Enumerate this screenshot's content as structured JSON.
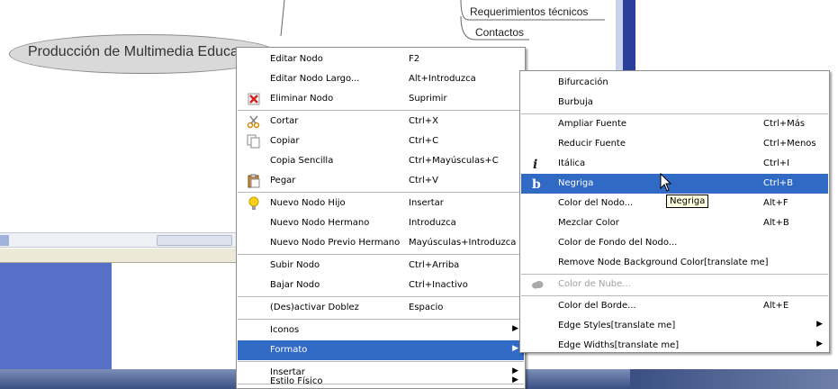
{
  "mindmap": {
    "root_label": "Producción de Multimedia Educa",
    "children": [
      "Requerimientos técnicos",
      "Contactos"
    ]
  },
  "context_menu": {
    "items": [
      {
        "label": "Editar Nodo",
        "shortcut": "F2",
        "icon": null
      },
      {
        "label": "Editar Nodo Largo...",
        "shortcut": "Alt+Introduzca",
        "icon": null
      },
      {
        "label": "Eliminar Nodo",
        "shortcut": "Suprimir",
        "icon": "red-x-delete-icon"
      },
      {
        "label": "Cortar",
        "shortcut": "Ctrl+X",
        "icon": "scissors-icon"
      },
      {
        "label": "Copiar",
        "shortcut": "Ctrl+C",
        "icon": "copy-documents-icon"
      },
      {
        "label": "Copia Sencilla",
        "shortcut": "Ctrl+Mayúsculas+C",
        "icon": null
      },
      {
        "label": "Pegar",
        "shortcut": "Ctrl+V",
        "icon": "clipboard-paste-icon"
      },
      {
        "label": "Nuevo Nodo Hijo",
        "shortcut": "Insertar",
        "icon": "lightbulb-icon"
      },
      {
        "label": "Nuevo Nodo Hermano",
        "shortcut": "Introduzca",
        "icon": null
      },
      {
        "label": "Nuevo Nodo Previo Hermano",
        "shortcut": "Mayúsculas+Introduzca",
        "icon": null
      },
      {
        "label": "Subir Nodo",
        "shortcut": "Ctrl+Arriba",
        "icon": null
      },
      {
        "label": "Bajar Nodo",
        "shortcut": "Ctrl+Inactivo",
        "icon": null
      },
      {
        "label": "(Des)activar Doblez",
        "shortcut": "Espacio",
        "icon": null
      },
      {
        "label": "Iconos",
        "shortcut": "",
        "icon": null,
        "submenu": true
      },
      {
        "label": "Formato",
        "shortcut": "",
        "icon": null,
        "submenu": true,
        "highlighted": true
      },
      {
        "label": "Insertar",
        "shortcut": "",
        "icon": null,
        "submenu": true
      },
      {
        "label": "Estilo Físico",
        "shortcut": "",
        "icon": null,
        "submenu": true
      }
    ]
  },
  "format_submenu": {
    "items": [
      {
        "label": "Bifurcación",
        "shortcut": ""
      },
      {
        "label": "Burbuja",
        "shortcut": ""
      },
      {
        "label": "Ampliar Fuente",
        "shortcut": "Ctrl+Más"
      },
      {
        "label": "Reducir Fuente",
        "shortcut": "Ctrl+Menos"
      },
      {
        "label": "Itálica",
        "shortcut": "Ctrl+I",
        "icon": "italic-i-icon"
      },
      {
        "label": "Negriga",
        "shortcut": "Ctrl+B",
        "icon": "bold-b-icon",
        "highlighted": true
      },
      {
        "label": "Color del Nodo...",
        "shortcut": "Alt+F"
      },
      {
        "label": "Mezclar Color",
        "shortcut": "Alt+B"
      },
      {
        "label": "Color de Fondo del Nodo...",
        "shortcut": ""
      },
      {
        "label": "Remove Node Background Color[translate me]",
        "shortcut": ""
      },
      {
        "label": "Color de Nube...",
        "shortcut": "",
        "icon": "cloud-icon",
        "disabled": true
      },
      {
        "label": "Color del Borde...",
        "shortcut": "Alt+E"
      },
      {
        "label": "Edge Styles[translate me]",
        "shortcut": "",
        "submenu": true
      },
      {
        "label": "Edge Widths[translate me]",
        "shortcut": "",
        "submenu": true
      }
    ]
  },
  "tooltip": "Negriga",
  "colors": {
    "highlight": "#316ac5",
    "menu_border": "#8d8d8d",
    "root_node_fill": "#d9d9d9",
    "tooltip_bg": "#ffffe1"
  }
}
